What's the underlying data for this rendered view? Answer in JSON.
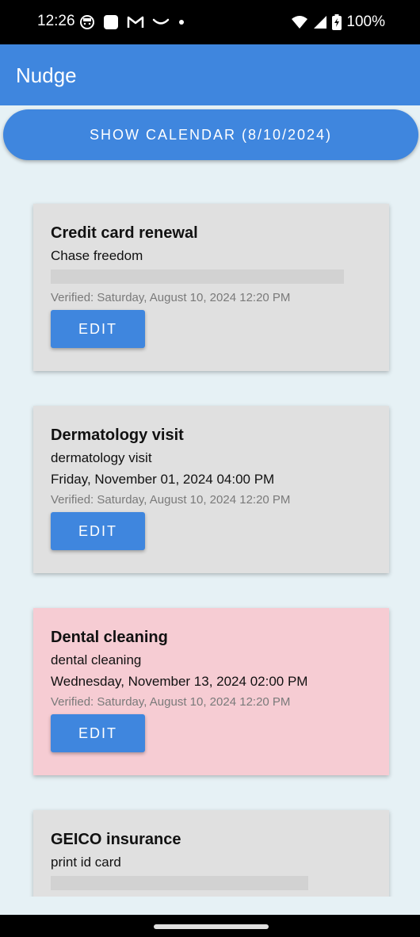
{
  "status_bar": {
    "time": "12:26",
    "battery": "100%",
    "icons": [
      "face-icon",
      "square-icon",
      "gmail-icon",
      "smile-icon",
      "dot-icon",
      "wifi-icon",
      "signal-icon",
      "battery-icon"
    ]
  },
  "app": {
    "title": "Nudge",
    "accent_color": "#3f86de"
  },
  "show_calendar": {
    "label": "SHOW CALENDAR (8/10/2024)"
  },
  "cards": [
    {
      "title": "Credit card renewal",
      "subtitle": "Chase freedom",
      "date": "",
      "verified": "Verified: Saturday, August 10, 2024 12:20 PM",
      "edit_label": "EDIT",
      "highlight": false
    },
    {
      "title": "Dermatology visit",
      "subtitle": "dermatology visit",
      "date": "Friday, November 01, 2024 04:00 PM",
      "verified": "Verified: Saturday, August 10, 2024 12:20 PM",
      "edit_label": "EDIT",
      "highlight": false
    },
    {
      "title": "Dental cleaning",
      "subtitle": "dental cleaning",
      "date": "Wednesday, November 13, 2024 02:00 PM",
      "verified": "Verified: Saturday, August 10, 2024 12:20 PM",
      "edit_label": "EDIT",
      "highlight": true
    },
    {
      "title": "GEICO insurance",
      "subtitle": "print id card",
      "date": "",
      "verified": "",
      "edit_label": "",
      "highlight": false
    }
  ]
}
